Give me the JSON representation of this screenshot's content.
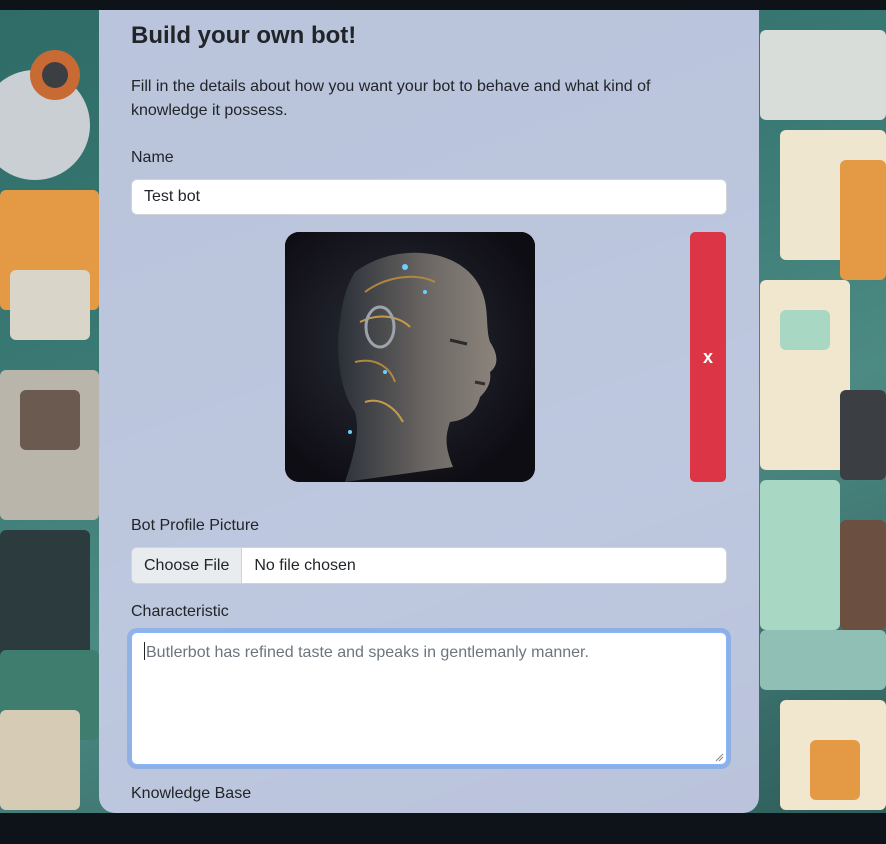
{
  "form": {
    "title": "Build your own bot!",
    "intro": "Fill in the details about how you want your bot to behave and what kind of knowledge it possess.",
    "name_label": "Name",
    "name_value": "Test bot",
    "remove_picture_label": "x",
    "picture_label": "Bot Profile Picture",
    "file_button_label": "Choose File",
    "file_status": "No file chosen",
    "characteristic_label": "Characteristic",
    "characteristic_placeholder": "Butlerbot has refined taste and speaks in gentlemanly manner.",
    "knowledge_label": "Knowledge Base"
  },
  "icons": {
    "avatar": "robot-head-portrait"
  },
  "colors": {
    "card_bg": "#cdd0ec",
    "danger": "#dc3545",
    "focus_border": "#86b7fe",
    "page_bg": "#0e1319"
  }
}
